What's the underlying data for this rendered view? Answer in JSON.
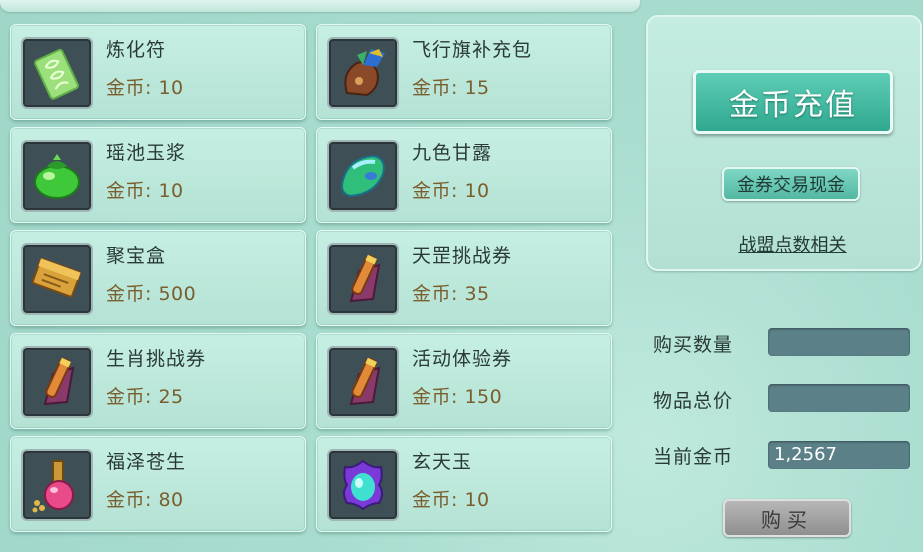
{
  "items": [
    {
      "name": "炼化符",
      "price": "金币: 10",
      "icon": "talisman-icon"
    },
    {
      "name": "飞行旗补充包",
      "price": "金币: 15",
      "icon": "flag-bag-icon"
    },
    {
      "name": "瑶池玉浆",
      "price": "金币: 10",
      "icon": "green-potion-jar-icon"
    },
    {
      "name": "九色甘露",
      "price": "金币: 10",
      "icon": "jade-gem-icon"
    },
    {
      "name": "聚宝盒",
      "price": "金币: 500",
      "icon": "treasure-box-icon"
    },
    {
      "name": "天罡挑战券",
      "price": "金币: 35",
      "icon": "scroll-icon"
    },
    {
      "name": "生肖挑战券",
      "price": "金币: 25",
      "icon": "scroll-icon"
    },
    {
      "name": "活动体验券",
      "price": "金币: 150",
      "icon": "scroll-icon"
    },
    {
      "name": "福泽苍生",
      "price": "金币: 80",
      "icon": "pink-elixir-icon"
    },
    {
      "name": "玄天玉",
      "price": "金币: 10",
      "icon": "dark-jade-icon"
    }
  ],
  "side": {
    "recharge_label": "金币充值",
    "exchange_label": "金券交易现金",
    "alliance_label": "战盟点数相关"
  },
  "purchase": {
    "quantity_label": "购买数量",
    "quantity_value": "",
    "total_label": "物品总价",
    "total_value": "",
    "gold_label": "当前金币",
    "gold_value": "1,2567",
    "buy_label": "购买"
  },
  "colors": {
    "accent": "#2fa88f",
    "price_text": "#7a5f2e",
    "field_bg": "#5b8088"
  }
}
